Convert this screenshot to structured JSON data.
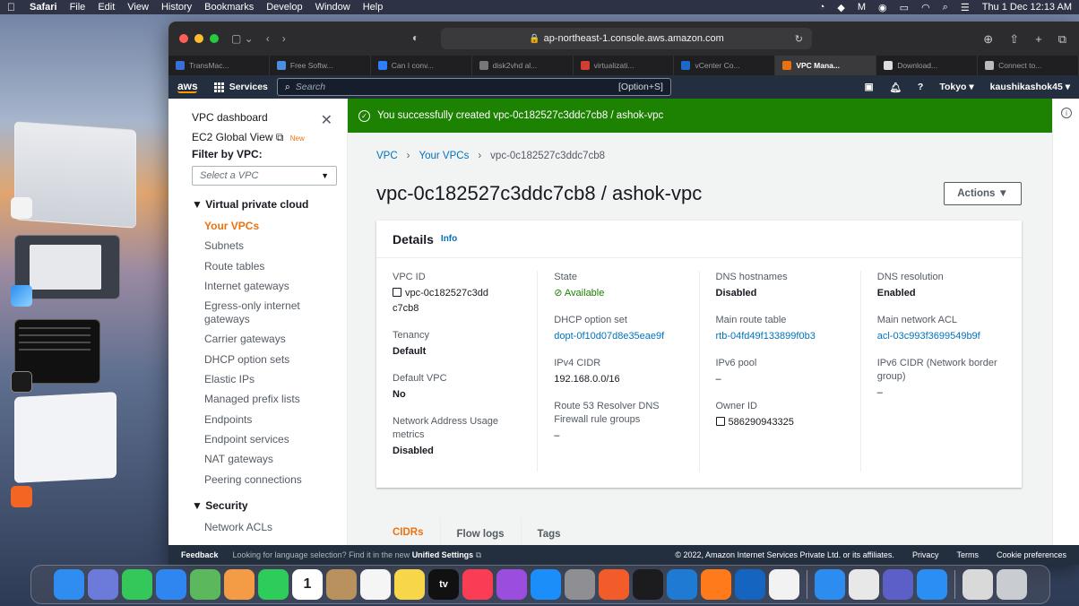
{
  "menubar": {
    "app": "Safari",
    "items": [
      "File",
      "Edit",
      "View",
      "History",
      "Bookmarks",
      "Develop",
      "Window",
      "Help"
    ],
    "clock": "Thu 1 Dec  12:13 AM"
  },
  "browser": {
    "url": "ap-northeast-1.console.aws.amazon.com",
    "tabs": [
      {
        "label": "TransMac...",
        "color": "#3a6fd8"
      },
      {
        "label": "Free Softw...",
        "color": "#4a90e2"
      },
      {
        "label": "Can I conv...",
        "color": "#2d7ff9"
      },
      {
        "label": "disk2vhd al...",
        "color": "#777777"
      },
      {
        "label": "virtualizati...",
        "color": "#d23f31"
      },
      {
        "label": "vCenter Co...",
        "color": "#1b6ac9"
      },
      {
        "label": "VPC Mana...",
        "color": "#ec7211"
      },
      {
        "label": "Download...",
        "color": "#dddddd"
      },
      {
        "label": "Connect to...",
        "color": "#bbbbbb"
      }
    ],
    "active_tab": 6
  },
  "aws_header": {
    "logo": "aws",
    "services": "Services",
    "search_placeholder": "Search",
    "search_shortcut": "[Option+S]",
    "region": "Tokyo ▾",
    "account": "kaushikashok45 ▾"
  },
  "sidenav": {
    "dashboard": "VPC dashboard",
    "ec2_global": "EC2 Global View",
    "new_badge": "New",
    "filter_label": "Filter by VPC:",
    "filter_placeholder": "Select a VPC",
    "section_vpc": "▼ Virtual private cloud",
    "items": [
      "Your VPCs",
      "Subnets",
      "Route tables",
      "Internet gateways",
      "Egress-only internet gateways",
      "Carrier gateways",
      "DHCP option sets",
      "Elastic IPs",
      "Managed prefix lists",
      "Endpoints",
      "Endpoint services",
      "NAT gateways",
      "Peering connections"
    ],
    "section_security": "▼ Security",
    "security_first": "Network ACLs"
  },
  "flash": {
    "message": "You successfully created vpc-0c182527c3ddc7cb8 / ashok-vpc"
  },
  "breadcrumb": {
    "root": "VPC",
    "parent": "Your VPCs",
    "current": "vpc-0c182527c3ddc7cb8"
  },
  "page_title": "vpc-0c182527c3ddc7cb8 / ashok-vpc",
  "actions_label": "Actions ▼",
  "details": {
    "title": "Details",
    "info": "Info",
    "vpc_id_label": "VPC ID",
    "vpc_id_value": "vpc-0c182527c3ddc7cb8",
    "tenancy_label": "Tenancy",
    "tenancy_value": "Default",
    "default_vpc_label": "Default VPC",
    "default_vpc_value": "No",
    "nau_label": "Network Address Usage metrics",
    "nau_value": "Disabled",
    "state_label": "State",
    "state_value": "Available",
    "dhcp_label": "DHCP option set",
    "dhcp_value": "dopt-0f10d07d8e35eae9f",
    "ipv4_label": "IPv4 CIDR",
    "ipv4_value": "192.168.0.0/16",
    "r53_label": "Route 53 Resolver DNS Firewall rule groups",
    "r53_value": "–",
    "dns_hostnames_label": "DNS hostnames",
    "dns_hostnames_value": "Disabled",
    "main_rt_label": "Main route table",
    "main_rt_value": "rtb-04fd49f133899f0b3",
    "ipv6_pool_label": "IPv6 pool",
    "ipv6_pool_value": "–",
    "owner_label": "Owner ID",
    "owner_value": "586290943325",
    "dns_res_label": "DNS resolution",
    "dns_res_value": "Enabled",
    "main_acl_label": "Main network ACL",
    "main_acl_value": "acl-03c993f3699549b9f",
    "ipv6_cidr_label": "IPv6 CIDR (Network border group)",
    "ipv6_cidr_value": "–"
  },
  "subtabs": [
    "CIDRs",
    "Flow logs",
    "Tags"
  ],
  "footer": {
    "feedback": "Feedback",
    "lang_text": "Looking for language selection? Find it in the new",
    "lang_link": "Unified Settings",
    "copyright": "© 2022, Amazon Internet Services Private Ltd. or its affiliates.",
    "privacy": "Privacy",
    "terms": "Terms",
    "cookies": "Cookie preferences"
  },
  "dock": {
    "calendar_day": "1",
    "tv_label": "tv",
    "apps": [
      {
        "name": "finder",
        "color": "#2f8cf0"
      },
      {
        "name": "launchpad",
        "color": "#6c7bd9"
      },
      {
        "name": "messages",
        "color": "#34c759"
      },
      {
        "name": "mail",
        "color": "#2f86f0"
      },
      {
        "name": "maps",
        "color": "#5cb85c"
      },
      {
        "name": "photos",
        "color": "#f39c45"
      },
      {
        "name": "facetime",
        "color": "#2ecc5b"
      },
      {
        "name": "calendar",
        "color": "#ffffff"
      },
      {
        "name": "contacts",
        "color": "#b8915e"
      },
      {
        "name": "reminders",
        "color": "#f5f5f5"
      },
      {
        "name": "notes",
        "color": "#f7d64a"
      },
      {
        "name": "tv",
        "color": "#111111"
      },
      {
        "name": "music",
        "color": "#fa3c55"
      },
      {
        "name": "podcasts",
        "color": "#9b4ede"
      },
      {
        "name": "app-store",
        "color": "#1c8ef9"
      },
      {
        "name": "system-preferences",
        "color": "#8e8e93"
      },
      {
        "name": "brave",
        "color": "#f25c2a"
      },
      {
        "name": "terminal",
        "color": "#1c1c1e"
      },
      {
        "name": "vscode",
        "color": "#1f7ad4"
      },
      {
        "name": "firefox",
        "color": "#ff7a1a"
      },
      {
        "name": "outlook",
        "color": "#1464c0"
      },
      {
        "name": "document",
        "color": "#f2f2f2"
      },
      {
        "name": "safari",
        "color": "#2d8cf0"
      },
      {
        "name": "textedit",
        "color": "#e8e8e8"
      },
      {
        "name": "teams",
        "color": "#5b5fc7"
      },
      {
        "name": "keynote",
        "color": "#2a8ff3"
      },
      {
        "name": "preview",
        "color": "#d9d9d9"
      },
      {
        "name": "trash",
        "color": "#c9ccd1"
      }
    ]
  }
}
